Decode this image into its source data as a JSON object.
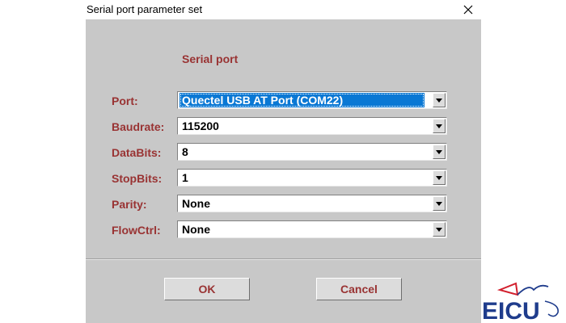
{
  "window": {
    "title": "Serial port parameter set"
  },
  "section": {
    "title": "Serial port"
  },
  "fields": [
    {
      "label": "Port:",
      "value": "Quectel USB AT Port (COM22)"
    },
    {
      "label": "Baudrate:",
      "value": "115200"
    },
    {
      "label": "DataBits:",
      "value": "8"
    },
    {
      "label": "StopBits:",
      "value": "1"
    },
    {
      "label": "Parity:",
      "value": "None"
    },
    {
      "label": "FlowCtrl:",
      "value": "None"
    }
  ],
  "buttons": {
    "ok": "OK",
    "cancel": "Cancel"
  },
  "logo": {
    "text": "EICU"
  },
  "colors": {
    "label": "#993333",
    "selection": "#0a78d4",
    "dialog_bg": "#c8c8c8",
    "logo_blue": "#1f3c8c",
    "logo_red": "#d21f2d"
  },
  "icons": {
    "close": "close-icon",
    "dropdown": "chevron-down-icon"
  }
}
